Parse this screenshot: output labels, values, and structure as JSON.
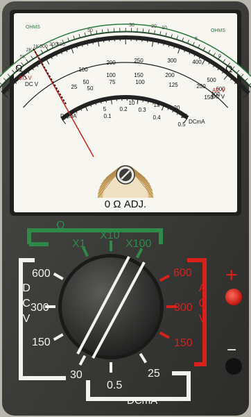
{
  "meter": {
    "ohms_label_left": "OHMS",
    "ohms_label_right": "OHMS",
    "ohm_symbol_left": "Ω",
    "ohm_symbol_right": "Ω",
    "ohm_scale_ticks": [
      "5K",
      "2K",
      "1K",
      "500",
      "200",
      "100",
      "50",
      "30",
      "20",
      "10",
      "5",
      "0"
    ],
    "ac_v_left": "AC V",
    "dc_v_left": "DC V",
    "ac_v_right": "AC V",
    "dc_v_right": "DC V",
    "dcma_left": "DCmA",
    "dcma_right": "DCmA",
    "v_row1": [
      "250",
      "300",
      "400",
      "500",
      "600"
    ],
    "v_row1_prefix": [
      "100",
      "200"
    ],
    "v_row2": [
      "50",
      "100",
      "150",
      "200",
      "250",
      "300"
    ],
    "v_row3": [
      "25",
      "50",
      "75",
      "100",
      "125",
      "150"
    ],
    "ma_row1": [
      "5",
      "10",
      "15",
      "20",
      "25"
    ],
    "ma_row2": [
      "0.1",
      "0.2",
      "0.3",
      "0.4",
      "0.5"
    ],
    "zero_adj_label": "0 Ω ADJ."
  },
  "dial": {
    "ohm_group_label": "Ω",
    "ohm_ranges": [
      "X1",
      "X10",
      "X100"
    ],
    "dcv_label_letters": [
      "D",
      "C",
      "V"
    ],
    "dcv_ranges": [
      "600",
      "300",
      "150",
      "30"
    ],
    "acv_label_letters": [
      "A",
      "C",
      "V"
    ],
    "acv_ranges": [
      "600",
      "300",
      "150"
    ],
    "dcma_label": "DCmA",
    "dcma_ranges": [
      "0.5",
      "25"
    ]
  },
  "jacks": {
    "plus_symbol": "+",
    "minus_symbol": "−"
  },
  "colors": {
    "body": "#3a3a38",
    "green": "#2f8a4a",
    "red": "#d8201c",
    "white": "#f2f2ee"
  }
}
